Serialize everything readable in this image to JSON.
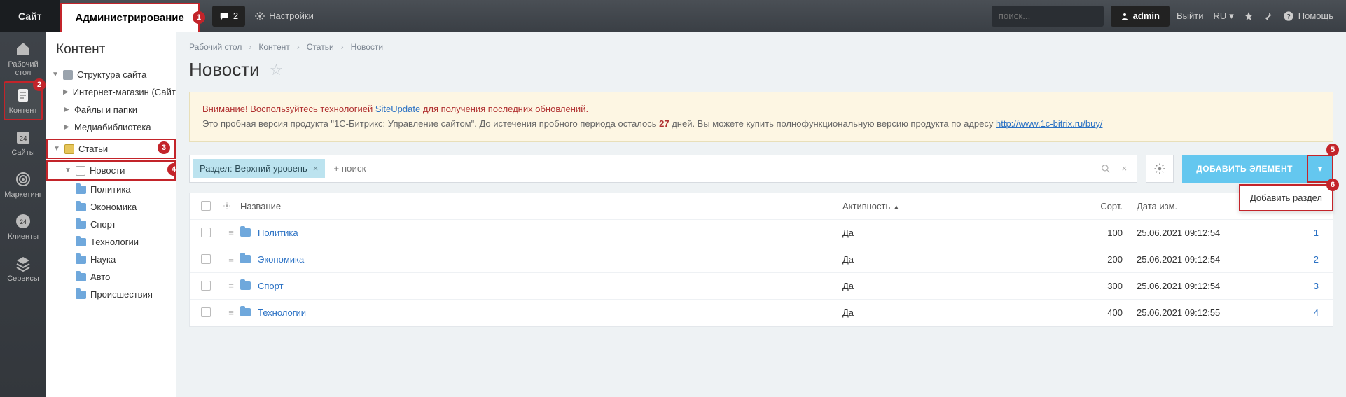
{
  "top": {
    "site_tab": "Сайт",
    "admin_tab": "Администрирование",
    "notice_count": "2",
    "settings": "Настройки",
    "search_placeholder": "поиск...",
    "user": "admin",
    "logout": "Выйти",
    "lang": "RU",
    "help": "Помощь"
  },
  "rail": {
    "desktop": "Рабочий\nстол",
    "content": "Контент",
    "sites": "Сайты",
    "marketing": "Маркетинг",
    "clients": "Клиенты",
    "services": "Сервисы"
  },
  "sidebar": {
    "title": "Контент",
    "struct": "Структура сайта",
    "shop": "Интернет-магазин (Сайт по",
    "files": "Файлы и папки",
    "media": "Медиабиблиотека",
    "articles": "Статьи",
    "news": "Новости",
    "cats": {
      "politics": "Политика",
      "economy": "Экономика",
      "sport": "Спорт",
      "tech": "Технологии",
      "science": "Наука",
      "auto": "Авто",
      "incidents": "Происшествия"
    }
  },
  "breadcrumbs": {
    "desktop": "Рабочий стол",
    "content": "Контент",
    "articles": "Статьи",
    "news": "Новости"
  },
  "page_title": "Новости",
  "warning": {
    "line1_prefix": "Внимание! Воспользуйтесь технологией ",
    "line1_link": "SiteUpdate",
    "line1_suffix": " для получения последних обновлений.",
    "line2_prefix": "Это пробная версия продукта \"1С-Битрикс: Управление сайтом\". До истечения пробного периода осталось ",
    "days": "27",
    "line2_mid": " дней. Вы можете купить полнофункциональную версию продукта по адресу ",
    "line2_link": "http://www.1c-bitrix.ru/buy/"
  },
  "filter": {
    "tag_label": "Раздел: Верхний уровень",
    "placeholder": "+ поиск"
  },
  "buttons": {
    "add_element": "ДОБАВИТЬ ЭЛЕМЕНТ",
    "add_section": "Добавить раздел"
  },
  "table": {
    "headers": {
      "name": "Название",
      "active": "Активность",
      "sort": "Сорт.",
      "date": "Дата изм."
    },
    "rows": [
      {
        "name": "Политика",
        "active": "Да",
        "sort": "100",
        "date": "25.06.2021 09:12:54",
        "id": "1"
      },
      {
        "name": "Экономика",
        "active": "Да",
        "sort": "200",
        "date": "25.06.2021 09:12:54",
        "id": "2"
      },
      {
        "name": "Спорт",
        "active": "Да",
        "sort": "300",
        "date": "25.06.2021 09:12:54",
        "id": "3"
      },
      {
        "name": "Технологии",
        "active": "Да",
        "sort": "400",
        "date": "25.06.2021 09:12:55",
        "id": "4"
      }
    ]
  },
  "markers": {
    "m1": "1",
    "m2": "2",
    "m3": "3",
    "m4": "4",
    "m5": "5",
    "m6": "6"
  }
}
